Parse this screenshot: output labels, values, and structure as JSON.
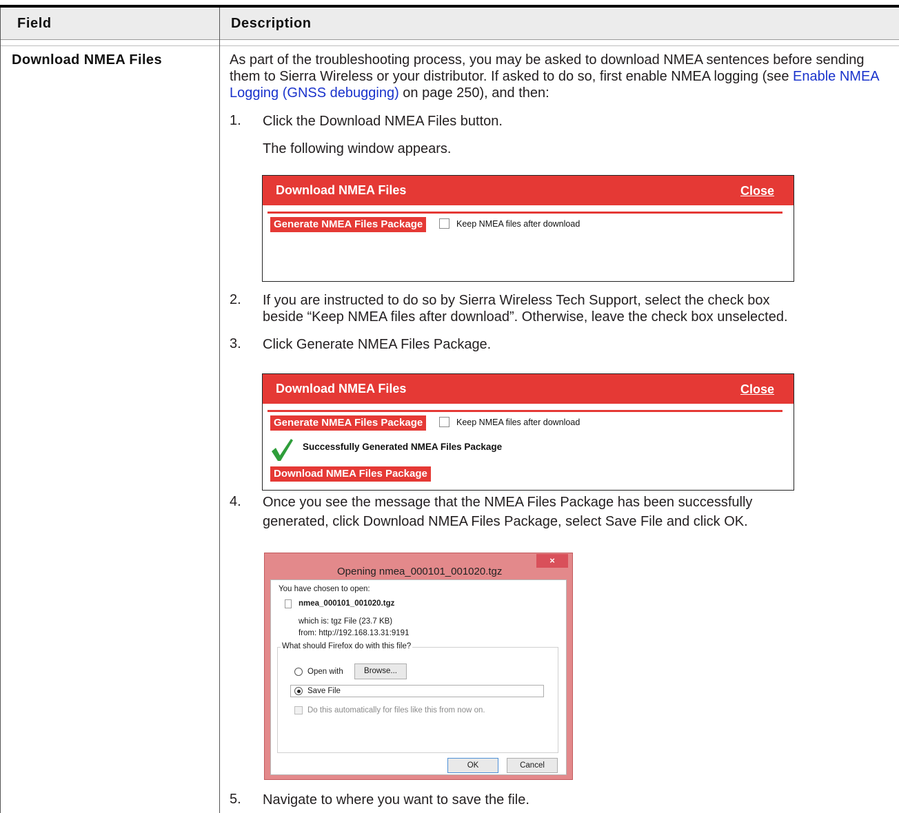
{
  "table": {
    "header_field": "Field",
    "header_description": "Description",
    "field_label": "Download NMEA Files"
  },
  "intro": {
    "part1": "As part of the troubleshooting process, you may be asked to download NMEA sentences before sending them to Sierra Wireless or your distributor. If asked to do so, first enable NMEA logging (see ",
    "link_text": "Enable NMEA Logging (GNSS debugging)",
    "part2": " on page 250), and then:"
  },
  "steps": [
    {
      "num": "1.",
      "text": "Click the Download NMEA Files button.",
      "subtext": "The following window appears."
    },
    {
      "num": "2.",
      "line1": "If you are instructed to do so by Sierra Wireless Tech Support, select the check box",
      "line2": "beside “Keep NMEA files after download”. Otherwise, leave the check box unselected."
    },
    {
      "num": "3.",
      "text": "Click Generate NMEA Files Package."
    },
    {
      "num": "4.",
      "line1": "Once you see the message that the NMEA Files Package has been successfully",
      "line2": "generated, click Download NMEA Files Package, select Save File and click OK."
    },
    {
      "num": "5.",
      "text": "Navigate to where you want to save the file."
    }
  ],
  "nmea_panel": {
    "title": "Download NMEA Files",
    "close_label": "Close",
    "generate_button": "Generate NMEA Files Package",
    "keep_checkbox_label": "Keep NMEA files after download",
    "keep_checked": false,
    "success_message": "Successfully Generated NMEA Files Package",
    "download_button": "Download NMEA Files Package",
    "accent_color": "#e53935"
  },
  "firefox_dialog": {
    "title": "Opening nmea_000101_001020.tgz",
    "close_glyph": "×",
    "chosen_label": "You have chosen to open:",
    "file_name": "nmea_000101_001020.tgz",
    "which_is": "which is: tgz File (23.7 KB)",
    "from": "from: http://192.168.13.31:9191",
    "question": "What should Firefox do with this file?",
    "open_with_label": "Open with",
    "browse_button": "Browse...",
    "save_file_label": "Save File",
    "selected_option": "Save File",
    "auto_checkbox_label": "Do this automatically for files like this from now on.",
    "ok_button": "OK",
    "cancel_button": "Cancel"
  }
}
